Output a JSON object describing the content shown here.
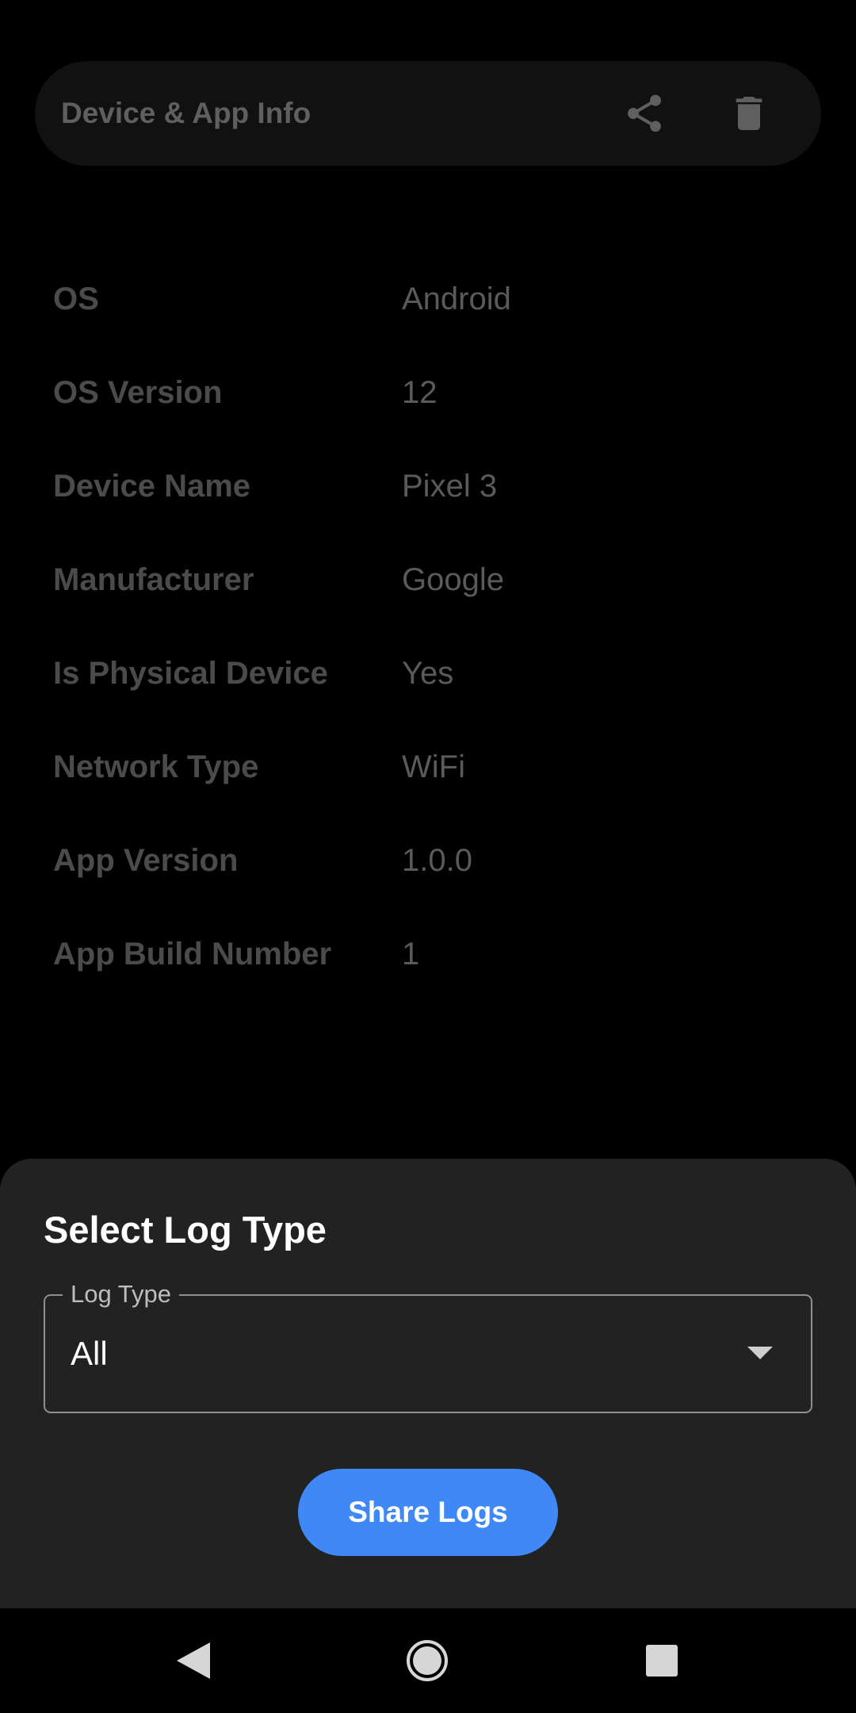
{
  "app_bar": {
    "title": "Device & App Info",
    "share_icon": "share-icon",
    "delete_icon": "delete-icon"
  },
  "info": {
    "rows": [
      {
        "label": "OS",
        "value": "Android"
      },
      {
        "label": "OS Version",
        "value": "12"
      },
      {
        "label": "Device Name",
        "value": "Pixel 3"
      },
      {
        "label": "Manufacturer",
        "value": "Google"
      },
      {
        "label": "Is Physical Device",
        "value": "Yes"
      },
      {
        "label": "Network Type",
        "value": "WiFi"
      },
      {
        "label": "App Version",
        "value": "1.0.0"
      },
      {
        "label": "App Build Number",
        "value": "1"
      }
    ]
  },
  "sheet": {
    "title": "Select Log Type",
    "log_type_label": "Log Type",
    "log_type_value": "All",
    "share_button": "Share Logs"
  },
  "colors": {
    "background": "#000000",
    "app_bar": "#111111",
    "sheet": "#222222",
    "accent": "#3f88f5"
  },
  "nav": {
    "back_icon": "back-triangle-icon",
    "home_icon": "home-circle-icon",
    "recents_icon": "recents-square-icon"
  }
}
